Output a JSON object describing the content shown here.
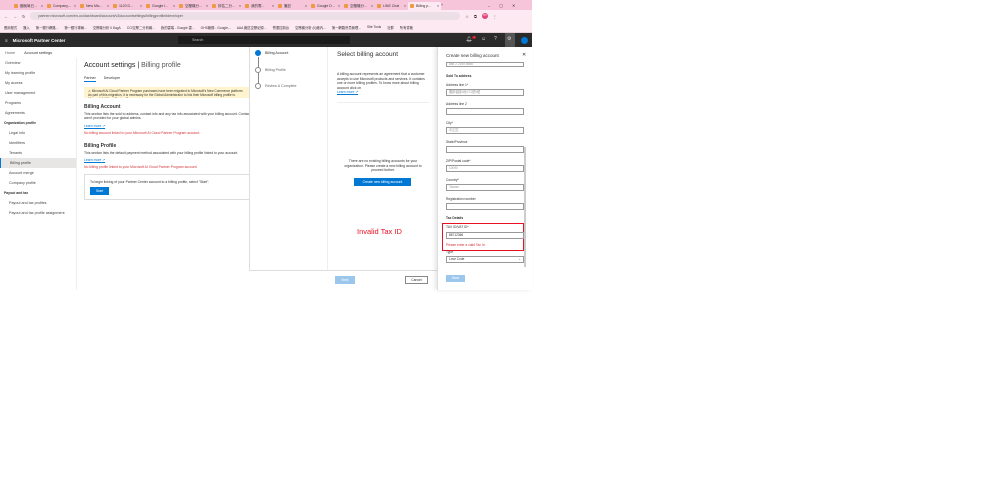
{
  "browser": {
    "tabs": [
      "國稅局已...",
      "Company...",
      "New Mic...",
      "1120 D...",
      "Google I...",
      "空壓機分...",
      "評估二分...",
      "我的電...",
      "筆記",
      "Google D...",
      "空壓機分...",
      "LINE Chat",
      "Billing p..."
    ],
    "url": "partner.microsoft.com/en-us/dashboard/account/v3/accountsettings/billingprofile#developer",
    "bookmarks": [
      "應用程式",
      "匯入",
      "第一銀行網路...",
      "第一銀行專屬...",
      "空壓機分析 II 8ugA",
      "CCI空壓二分析報...",
      "我的雲端 - Google 雲...",
      "GHS廠務 - Google...",
      "AAA 廠區空壓紀錄...",
      "營運控制台",
      "空壓機分析 (II)廠內...",
      "第一網路會員管理...",
      "Site Tools",
      "社群",
      "所有書籤"
    ],
    "profile_initials": "HH"
  },
  "header": {
    "app_title": "Microsoft Partner Center",
    "search_placeholder": "Search",
    "notification_count": "1"
  },
  "breadcrumb": [
    "Home",
    "Account settings"
  ],
  "nav": {
    "items": [
      "Overview",
      "My learning profile",
      "My access",
      "User management",
      "Programs",
      "Agreements"
    ],
    "org_heading": "Organization profile",
    "org_items": [
      "Legal info",
      "Identifiers",
      "Tenants",
      "Billing profile",
      "Account merge",
      "Company profile"
    ],
    "payout_heading": "Payout and tax",
    "payout_items": [
      "Payout and tax profiles",
      "Payout and tax profile assignment"
    ]
  },
  "main": {
    "title": "Account settings",
    "subtitle": "Billing profile",
    "tabs": [
      "Partner",
      "Developer"
    ],
    "warning": "Microsoft AI Cloud Partner Program purchases have been migrated to Microsoft's New Commerce platform. As part of this migration, it is necessary for the Global Administrator to link their Microsoft billing profile to Microsoft AI Cloud Partner Program.",
    "billing_account_title": "Billing Account",
    "billing_account_desc1": "This section lists the sold to address, contact info and any tax info associated with your billing account. Contact details",
    "billing_account_desc2": "aren't provided for your global admins.",
    "learn_more": "Learn more",
    "billing_account_error": "No billing account linked to your Microsoft AI Cloud Partner Program account.",
    "billing_profile_title": "Billing Profile",
    "billing_profile_desc": "This section lists the default payment method associated with your billing profile linked to your account.",
    "billing_profile_error": "No billing profile linked to your Microsoft AI Cloud Partner Program account.",
    "start_text": "To begin linking of your Partner Center account to a billing profile, select \"Start\".",
    "start_button": "Start"
  },
  "wizard": {
    "steps": [
      "Billing Account",
      "Billing Profile",
      "Review & Complete"
    ],
    "title": "Select billing account",
    "desc": "A billing account represents an agreement that a customer accepts to use Microsoft products and services. It contains one or more billing profiles. To know more about billing account click on",
    "learn_more": "Learn more",
    "empty": "There are no existing billing accounts for your organization. Please create a new billing account to proceed further.",
    "create_button": "Create new billing account",
    "annotation": "Invalid Tax ID",
    "next": "Next",
    "cancel": "Cancel"
  },
  "create_panel": {
    "title": "Create new billing account",
    "top_field": "886 2 2345 6666",
    "sold_to": "Sold To address",
    "fields": [
      {
        "label": "Address line 1*",
        "value": "羅斯福路3段272號5樓"
      },
      {
        "label": "Address line 2",
        "value": ""
      },
      {
        "label": "City*",
        "value": "中正區"
      },
      {
        "label": "State/Province",
        "value": ""
      },
      {
        "label": "ZIP/Postal code*",
        "value": "10090"
      },
      {
        "label": "Country*",
        "value": "Taiwan"
      },
      {
        "label": "Registration number",
        "value": ""
      }
    ],
    "tax_details": "Tax Details",
    "tax_label": "TAX ID/VAT ID*",
    "tax_value": "86712366",
    "tax_error": "Please enter a valid Tax Id.",
    "type_label": "Type",
    "type_value": "Love Code",
    "save": "Save"
  },
  "colors": {
    "accent": "#0078d4",
    "error": "#d13438",
    "highlight": "#e81123"
  }
}
